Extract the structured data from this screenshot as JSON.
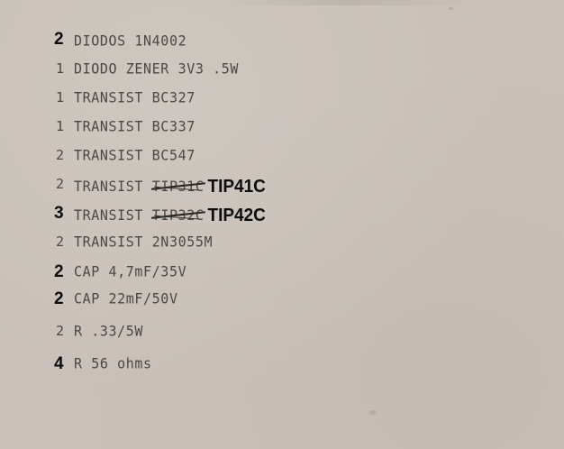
{
  "items": [
    {
      "qty": "2",
      "qty_style": "handwritten",
      "text": "DIODOS 1N4002"
    },
    {
      "qty": "1",
      "qty_style": "typed",
      "text": "DIODO ZENER 3V3 .5W"
    },
    {
      "qty": "1",
      "qty_style": "typed",
      "text": "TRANSIST BC327"
    },
    {
      "qty": "1",
      "qty_style": "typed",
      "text": "TRANSIST BC337"
    },
    {
      "qty": "2",
      "qty_style": "typed",
      "text": "TRANSIST BC547"
    },
    {
      "qty": "2",
      "qty_style": "typed",
      "text": "TRANSIST",
      "struck": "TIP31C",
      "replacement": "TIP41C"
    },
    {
      "qty": "3",
      "qty_style": "handwritten",
      "text": "TRANSIST",
      "struck": "TIP32C",
      "replacement": "TIP42C"
    },
    {
      "qty": "2",
      "qty_style": "typed",
      "text": "TRANSIST 2N3055M"
    },
    {
      "qty": "2",
      "qty_style": "handwritten",
      "text": "CAP 4,7mF/35V"
    },
    {
      "qty": "2",
      "qty_style": "handwritten",
      "text": "CAP 22mF/50V"
    },
    {
      "qty": "2",
      "qty_style": "typed",
      "text": "R .33/5W"
    },
    {
      "qty": "4",
      "qty_style": "handwritten",
      "text": "R 56 ohms"
    }
  ]
}
